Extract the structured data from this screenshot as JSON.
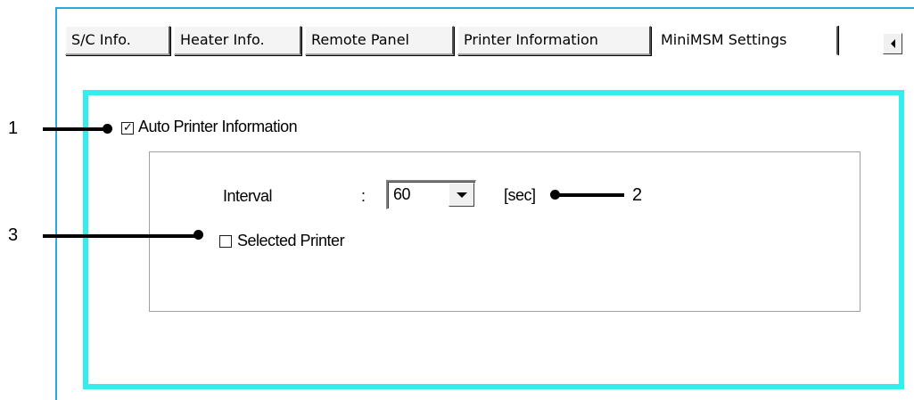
{
  "tabs": [
    {
      "label": "S/C Info."
    },
    {
      "label": "Heater Info."
    },
    {
      "label": "Remote Panel"
    },
    {
      "label": "Printer Information"
    },
    {
      "label": "MiniMSM Settings",
      "active": true
    }
  ],
  "tab_scroll_icon": "arrow-left-icon",
  "auto_printer": {
    "label": "Auto Printer Information",
    "checked": true
  },
  "interval": {
    "label": "Interval",
    "separator": ":",
    "value": "60",
    "unit": "[sec]"
  },
  "selected_printer": {
    "label": "Selected Printer",
    "checked": false
  },
  "callouts": {
    "c1": "1",
    "c2": "2",
    "c3": "3"
  },
  "colors": {
    "highlight": "#33eeee",
    "frame": "#29a9e1"
  }
}
